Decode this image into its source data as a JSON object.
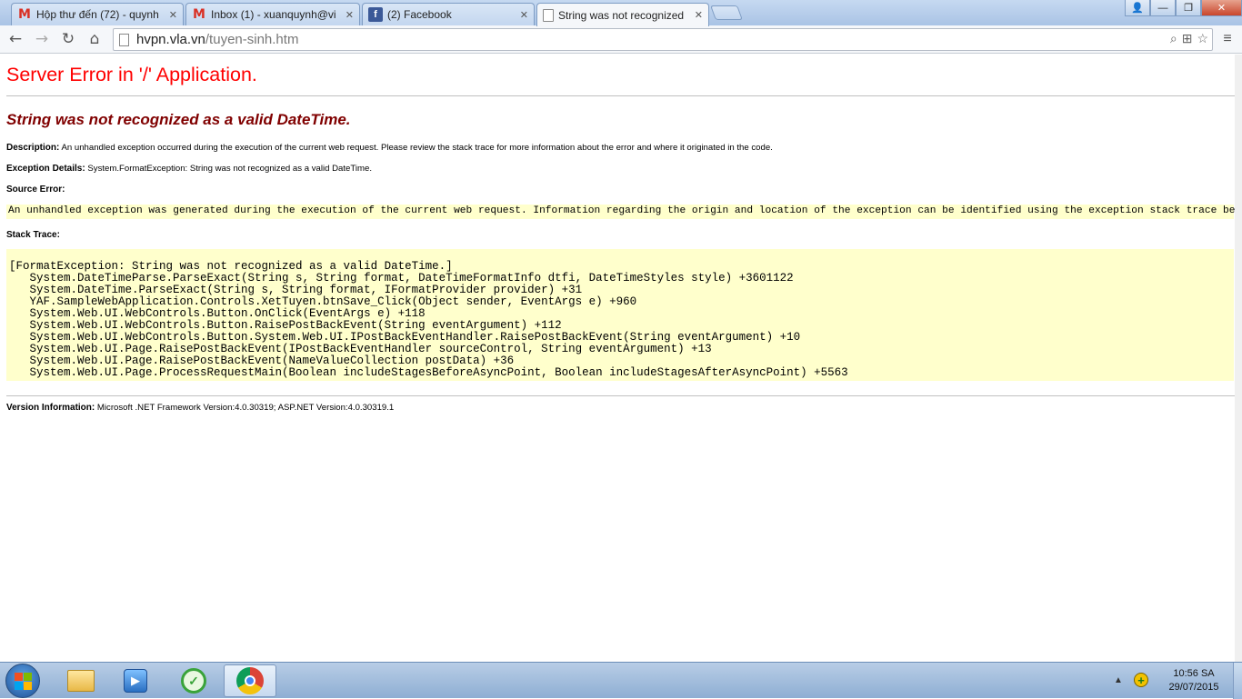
{
  "tabs": [
    {
      "title": "Hộp thư đến (72) - quynh",
      "icon": "gmail-icon",
      "close": "✕"
    },
    {
      "title": "Inbox (1) - xuanquynh@vi",
      "icon": "gmail-icon",
      "close": "✕"
    },
    {
      "title": "(2) Facebook",
      "icon": "facebook-icon",
      "close": "✕"
    },
    {
      "title": "String was not recognized",
      "icon": "page-icon",
      "close": "✕"
    }
  ],
  "window_controls": {
    "user": "👤",
    "minimize": "—",
    "restore": "❐",
    "close": "✕"
  },
  "toolbar": {
    "back": "←",
    "forward": "→",
    "reload": "↻",
    "home": "⌂",
    "url_host": "hvpn.vla.vn",
    "url_path": "/tuyen-sinh.htm",
    "menu": "≡"
  },
  "page": {
    "title": "Server Error in '/' Application.",
    "subtitle": "String was not recognized as a valid DateTime.",
    "description_label": "Description:",
    "description_text": " An unhandled exception occurred during the execution of the current web request. Please review the stack trace for more information about the error and where it originated in the code.",
    "exception_label": "Exception Details:",
    "exception_text": " System.FormatException: String was not recognized as a valid DateTime.",
    "source_error_label": "Source Error:",
    "source_error_text": "An unhandled exception was generated during the execution of the current web request. Information regarding the origin and location of the exception can be identified using the exception stack trace below.",
    "stack_trace_label": "Stack Trace:",
    "stack_trace": [
      "[FormatException: String was not recognized as a valid DateTime.]",
      "   System.DateTimeParse.ParseExact(String s, String format, DateTimeFormatInfo dtfi, DateTimeStyles style) +3601122",
      "   System.DateTime.ParseExact(String s, String format, IFormatProvider provider) +31",
      "   YAF.SampleWebApplication.Controls.XetTuyen.btnSave_Click(Object sender, EventArgs e) +960",
      "   System.Web.UI.WebControls.Button.OnClick(EventArgs e) +118",
      "   System.Web.UI.WebControls.Button.RaisePostBackEvent(String eventArgument) +112",
      "   System.Web.UI.WebControls.Button.System.Web.UI.IPostBackEventHandler.RaisePostBackEvent(String eventArgument) +10",
      "   System.Web.UI.Page.RaisePostBackEvent(IPostBackEventHandler sourceControl, String eventArgument) +13",
      "   System.Web.UI.Page.RaisePostBackEvent(NameValueCollection postData) +36",
      "   System.Web.UI.Page.ProcessRequestMain(Boolean includeStagesBeforeAsyncPoint, Boolean includeStagesAfterAsyncPoint) +5563"
    ],
    "version_label": "Version Information:",
    "version_text": " Microsoft .NET Framework Version:4.0.30319; ASP.NET Version:4.0.30319.1"
  },
  "taskbar": {
    "time": "10:56 SA",
    "date": "29/07/2015",
    "tray_arrow": "▲"
  },
  "colors": {
    "error_title": "#ff0000",
    "error_subtitle": "#800000",
    "code_background": "#ffffcc"
  }
}
